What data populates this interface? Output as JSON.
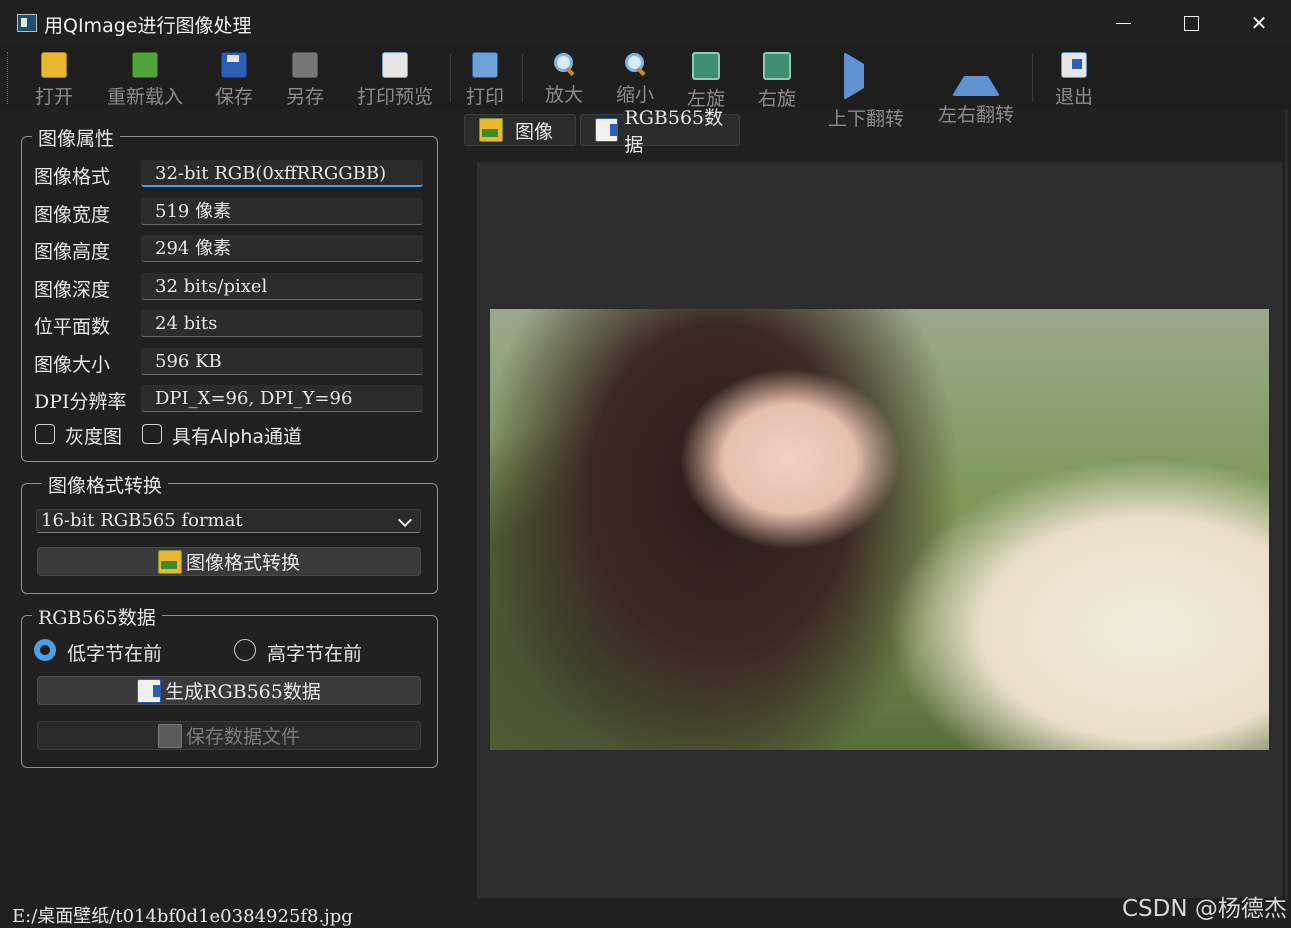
{
  "window": {
    "title": "用QImage进行图像处理",
    "controls": [
      "minimize",
      "maximize",
      "close"
    ]
  },
  "toolbar": {
    "items": [
      {
        "label": "打开",
        "icon": "folder-open-icon"
      },
      {
        "label": "重新载入",
        "icon": "reload-icon"
      },
      {
        "label": "保存",
        "icon": "save-icon"
      },
      {
        "label": "另存",
        "icon": "save-as-icon"
      },
      {
        "label": "打印预览",
        "icon": "print-preview-icon"
      },
      {
        "label": "打印",
        "icon": "printer-icon"
      },
      {
        "label": "放大",
        "icon": "zoom-in-icon"
      },
      {
        "label": "缩小",
        "icon": "zoom-out-icon"
      },
      {
        "label": "左旋",
        "icon": "rotate-left-icon"
      },
      {
        "label": "右旋",
        "icon": "rotate-right-icon"
      },
      {
        "label": "上下翻转",
        "icon": "flip-vertical-icon"
      },
      {
        "label": "左右翻转",
        "icon": "flip-horizontal-icon"
      },
      {
        "label": "退出",
        "icon": "exit-icon"
      }
    ]
  },
  "properties": {
    "title": "图像属性",
    "rows": [
      {
        "label": "图像格式",
        "value": "32-bit RGB(0xffRRGGBB)"
      },
      {
        "label": "图像宽度",
        "value": "519 像素"
      },
      {
        "label": "图像高度",
        "value": "294 像素"
      },
      {
        "label": "图像深度",
        "value": "32 bits/pixel"
      },
      {
        "label": "位平面数",
        "value": "24 bits"
      },
      {
        "label": "图像大小",
        "value": "596 KB"
      },
      {
        "label": "DPI分辨率",
        "value": "DPI_X=96, DPI_Y=96"
      }
    ],
    "checkboxes": [
      {
        "label": "灰度图",
        "checked": false
      },
      {
        "label": "具有Alpha通道",
        "checked": false
      }
    ]
  },
  "format_convert": {
    "title": "图像格式转换",
    "selected_format": "16-bit RGB565 format",
    "button_label": "图像格式转换"
  },
  "rgb565": {
    "title": "RGB565数据",
    "byte_order": [
      {
        "label": "低字节在前",
        "selected": true
      },
      {
        "label": "高字节在前",
        "selected": false
      }
    ],
    "generate_label": "生成RGB565数据",
    "save_label": "保存数据文件",
    "save_enabled": false
  },
  "tabs": [
    {
      "label": "图像",
      "icon": "image-icon",
      "active": true
    },
    {
      "label": "RGB565数据",
      "icon": "document-icon",
      "active": false
    }
  ],
  "status": {
    "file_path": "E:/桌面壁纸/t014bf0d1e0384925f8.jpg"
  },
  "watermark": "CSDN @杨德杰"
}
